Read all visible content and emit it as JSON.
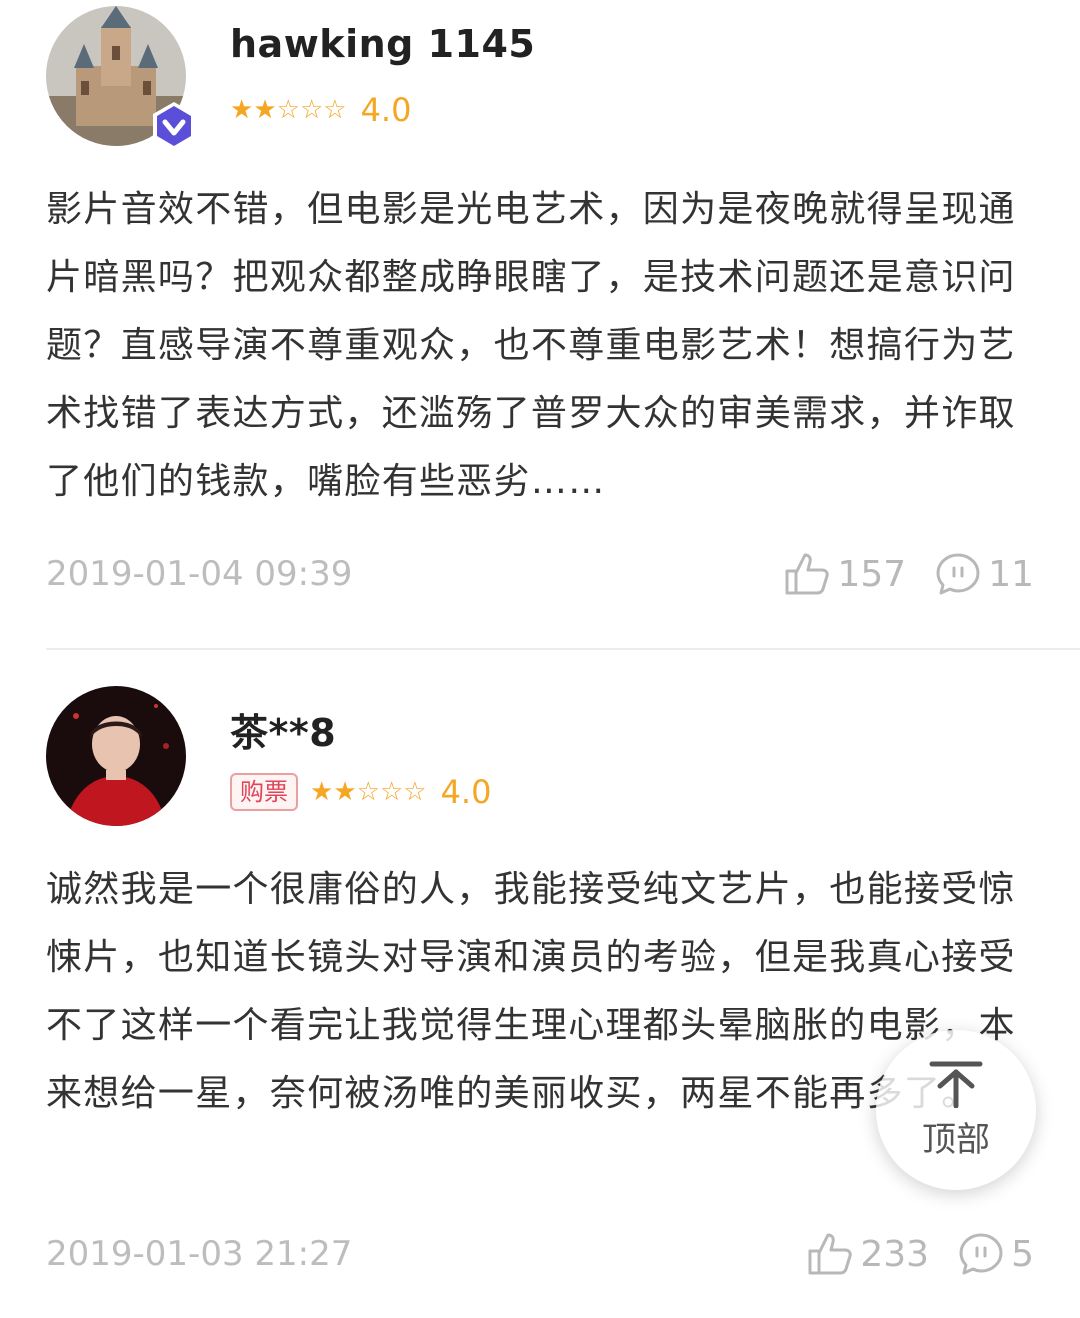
{
  "reviews": [
    {
      "username": "hawking 1145",
      "verified": true,
      "tag": "",
      "stars_filled": 2,
      "stars_total": 5,
      "score": "4.0",
      "text": "影片音效不错，但电影是光电艺术，因为是夜晚就得呈现通片暗黑吗？把观众都整成睁眼瞎了，是技术问题还是意识问题？直感导演不尊重观众，也不尊重电影艺术！想搞行为艺术找错了表达方式，还滥殇了普罗大众的审美需求，并诈取了他们的钱款，嘴脸有些恶劣……",
      "date": "2019-01-04 09:39",
      "likes": "157",
      "comments": "11"
    },
    {
      "username": "茶**8",
      "verified": false,
      "tag": "购票",
      "stars_filled": 2,
      "stars_total": 5,
      "score": "4.0",
      "text": "诚然我是一个很庸俗的人，我能接受纯文艺片，也能接受惊悚片，也知道长镜头对导演和演员的考验，但是我真心接受不了这样一个看完让我觉得生理心理都头晕脑胀的电影，本来想给一星，奈何被汤唯的美丽收买，两星不能再多了。",
      "date": "2019-01-03 21:27",
      "likes": "233",
      "comments": "5"
    }
  ],
  "back_to_top": {
    "label": "顶部",
    "icon": "arrow-up-icon"
  },
  "colors": {
    "star": "#f5a623",
    "meta": "#bdbdbd",
    "tag": "#e0455a",
    "verified": "#5b4fd9"
  }
}
